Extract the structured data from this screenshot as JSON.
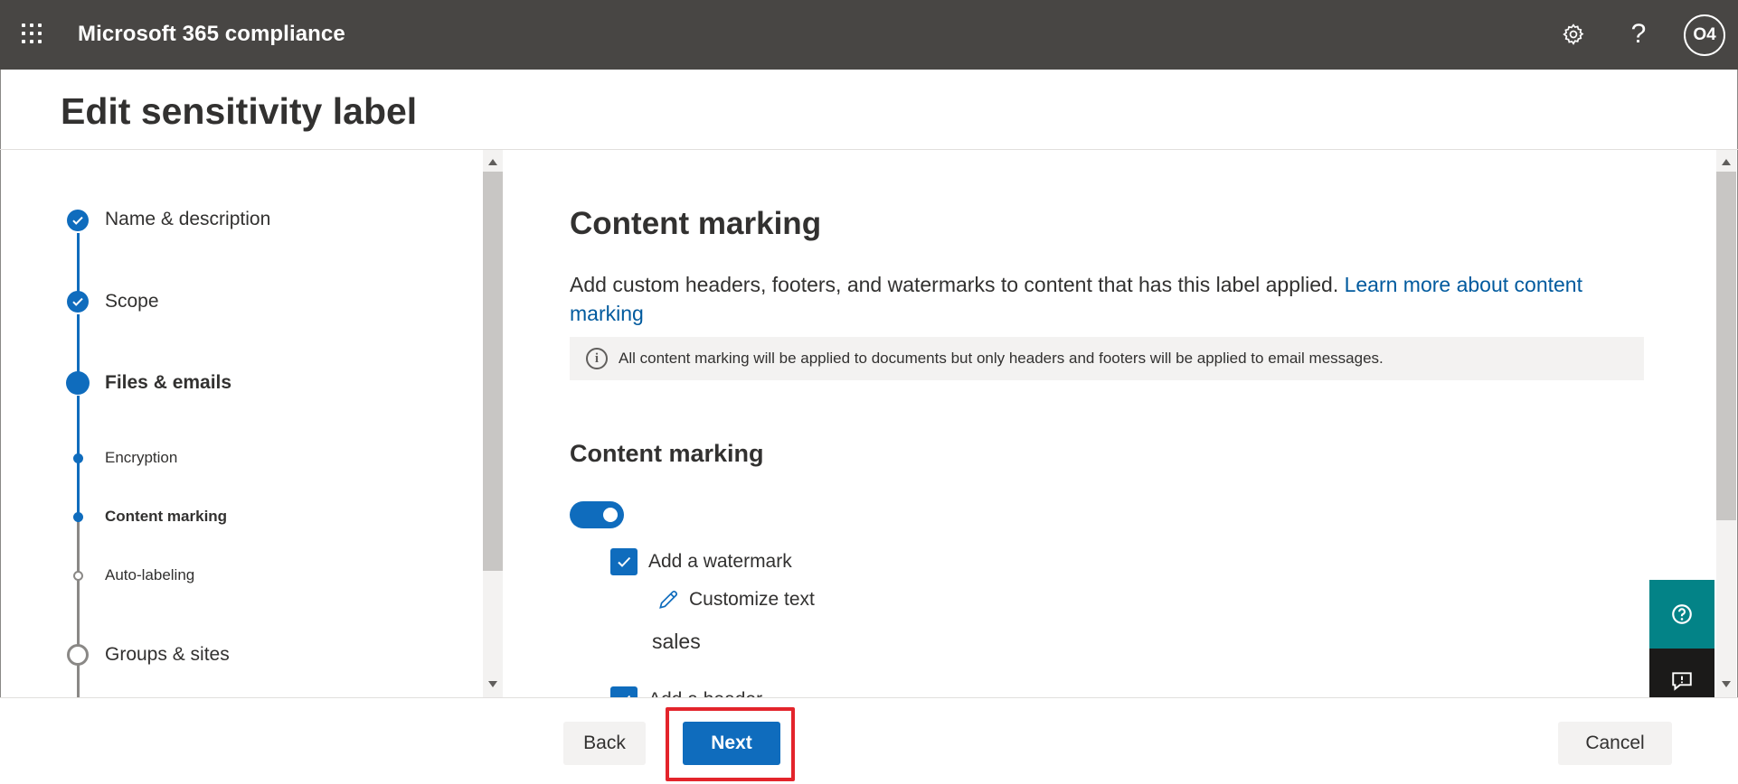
{
  "app": {
    "title": "Microsoft 365 compliance",
    "avatar_initials": "O4",
    "icons": [
      "waffle-icon",
      "gear-icon",
      "help-icon"
    ]
  },
  "page": {
    "title": "Edit sensitivity label"
  },
  "steps": [
    {
      "label": "Name & description",
      "state": "completed"
    },
    {
      "label": "Scope",
      "state": "completed"
    },
    {
      "label": "Files & emails",
      "state": "current"
    },
    {
      "label": "Encryption",
      "state": "substep-done"
    },
    {
      "label": "Content marking",
      "state": "substep-current"
    },
    {
      "label": "Auto-labeling",
      "state": "substep-pending"
    },
    {
      "label": "Groups & sites",
      "state": "pending"
    }
  ],
  "content": {
    "title": "Content marking",
    "description": "Add custom headers, footers, and watermarks to content that has this label applied.",
    "learn_more_line1": "Learn more about content",
    "learn_more_line2": "marking",
    "info": "All content marking will be applied to documents but only headers and footers will be applied to email messages.",
    "subtitle": "Content marking",
    "toggle_on": true,
    "watermark_label": "Add a watermark",
    "watermark_checked": true,
    "customize_text": "Customize text",
    "watermark_value": "sales",
    "next_option_label": "Add a header",
    "next_option_checked": true
  },
  "footer": {
    "back": "Back",
    "next": "Next",
    "cancel": "Cancel"
  },
  "colors": {
    "accent": "#0f6cbd",
    "topbar": "#484644",
    "help_float": "#038387",
    "highlight": "#e3242b"
  }
}
